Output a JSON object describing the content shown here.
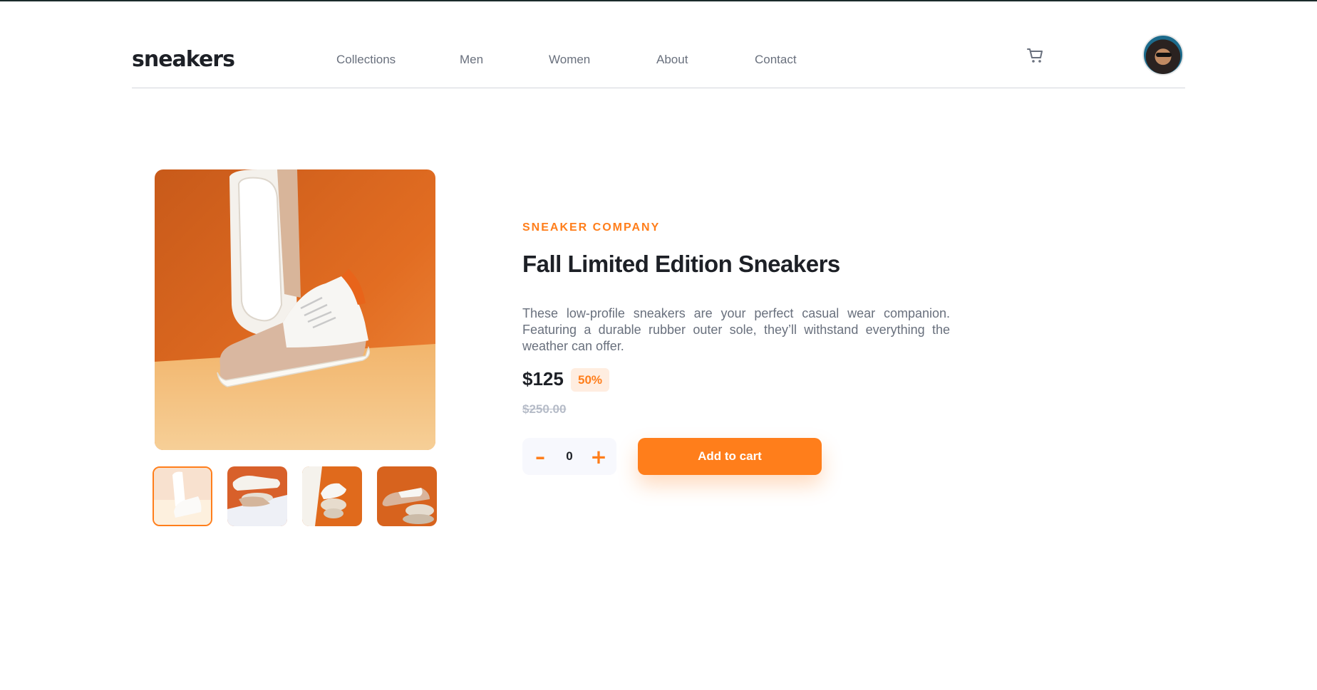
{
  "brand": {
    "logo": "sneakers",
    "accent": "#ff7e1b"
  },
  "nav": {
    "items": [
      "Collections",
      "Men",
      "Women",
      "About",
      "Contact"
    ]
  },
  "header": {
    "cart_icon": "cart-icon",
    "avatar": "user-avatar"
  },
  "gallery": {
    "main_image": "white-and-tan-sneaker-on-orange-background",
    "thumbnails": [
      "thumbnail-1",
      "thumbnail-2",
      "thumbnail-3",
      "thumbnail-4"
    ],
    "active_index": 0
  },
  "product": {
    "company": "SNEAKER COMPANY",
    "title": "Fall Limited Edition Sneakers",
    "description": "These low-profile sneakers are your perfect casual wear companion. Featuring a durable rubber outer sole, they’ll withstand everything the weather can offer.",
    "price": "$125",
    "discount": "50%",
    "original_price": "$250.00"
  },
  "cart_controls": {
    "minus": "–",
    "plus": "+",
    "quantity": "0",
    "add_label": "Add to cart"
  }
}
